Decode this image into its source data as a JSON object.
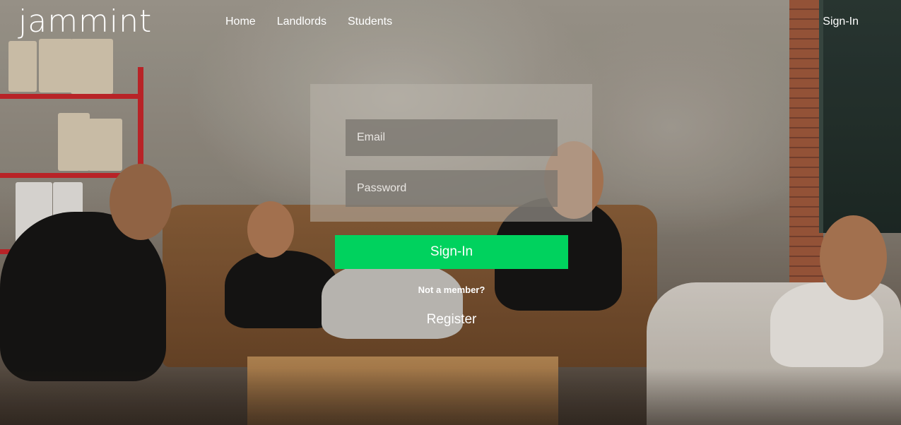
{
  "brand": {
    "logo_text": "jammint"
  },
  "nav": {
    "items": [
      {
        "label": "Home"
      },
      {
        "label": "Landlords"
      },
      {
        "label": "Students"
      }
    ],
    "signin_label": "Sign-In"
  },
  "login": {
    "email_placeholder": "Email",
    "password_placeholder": "Password",
    "submit_label": "Sign-In",
    "not_member_text": "Not a member?",
    "register_label": "Register"
  },
  "colors": {
    "accent_green": "#00d25e",
    "text": "#ffffff"
  }
}
